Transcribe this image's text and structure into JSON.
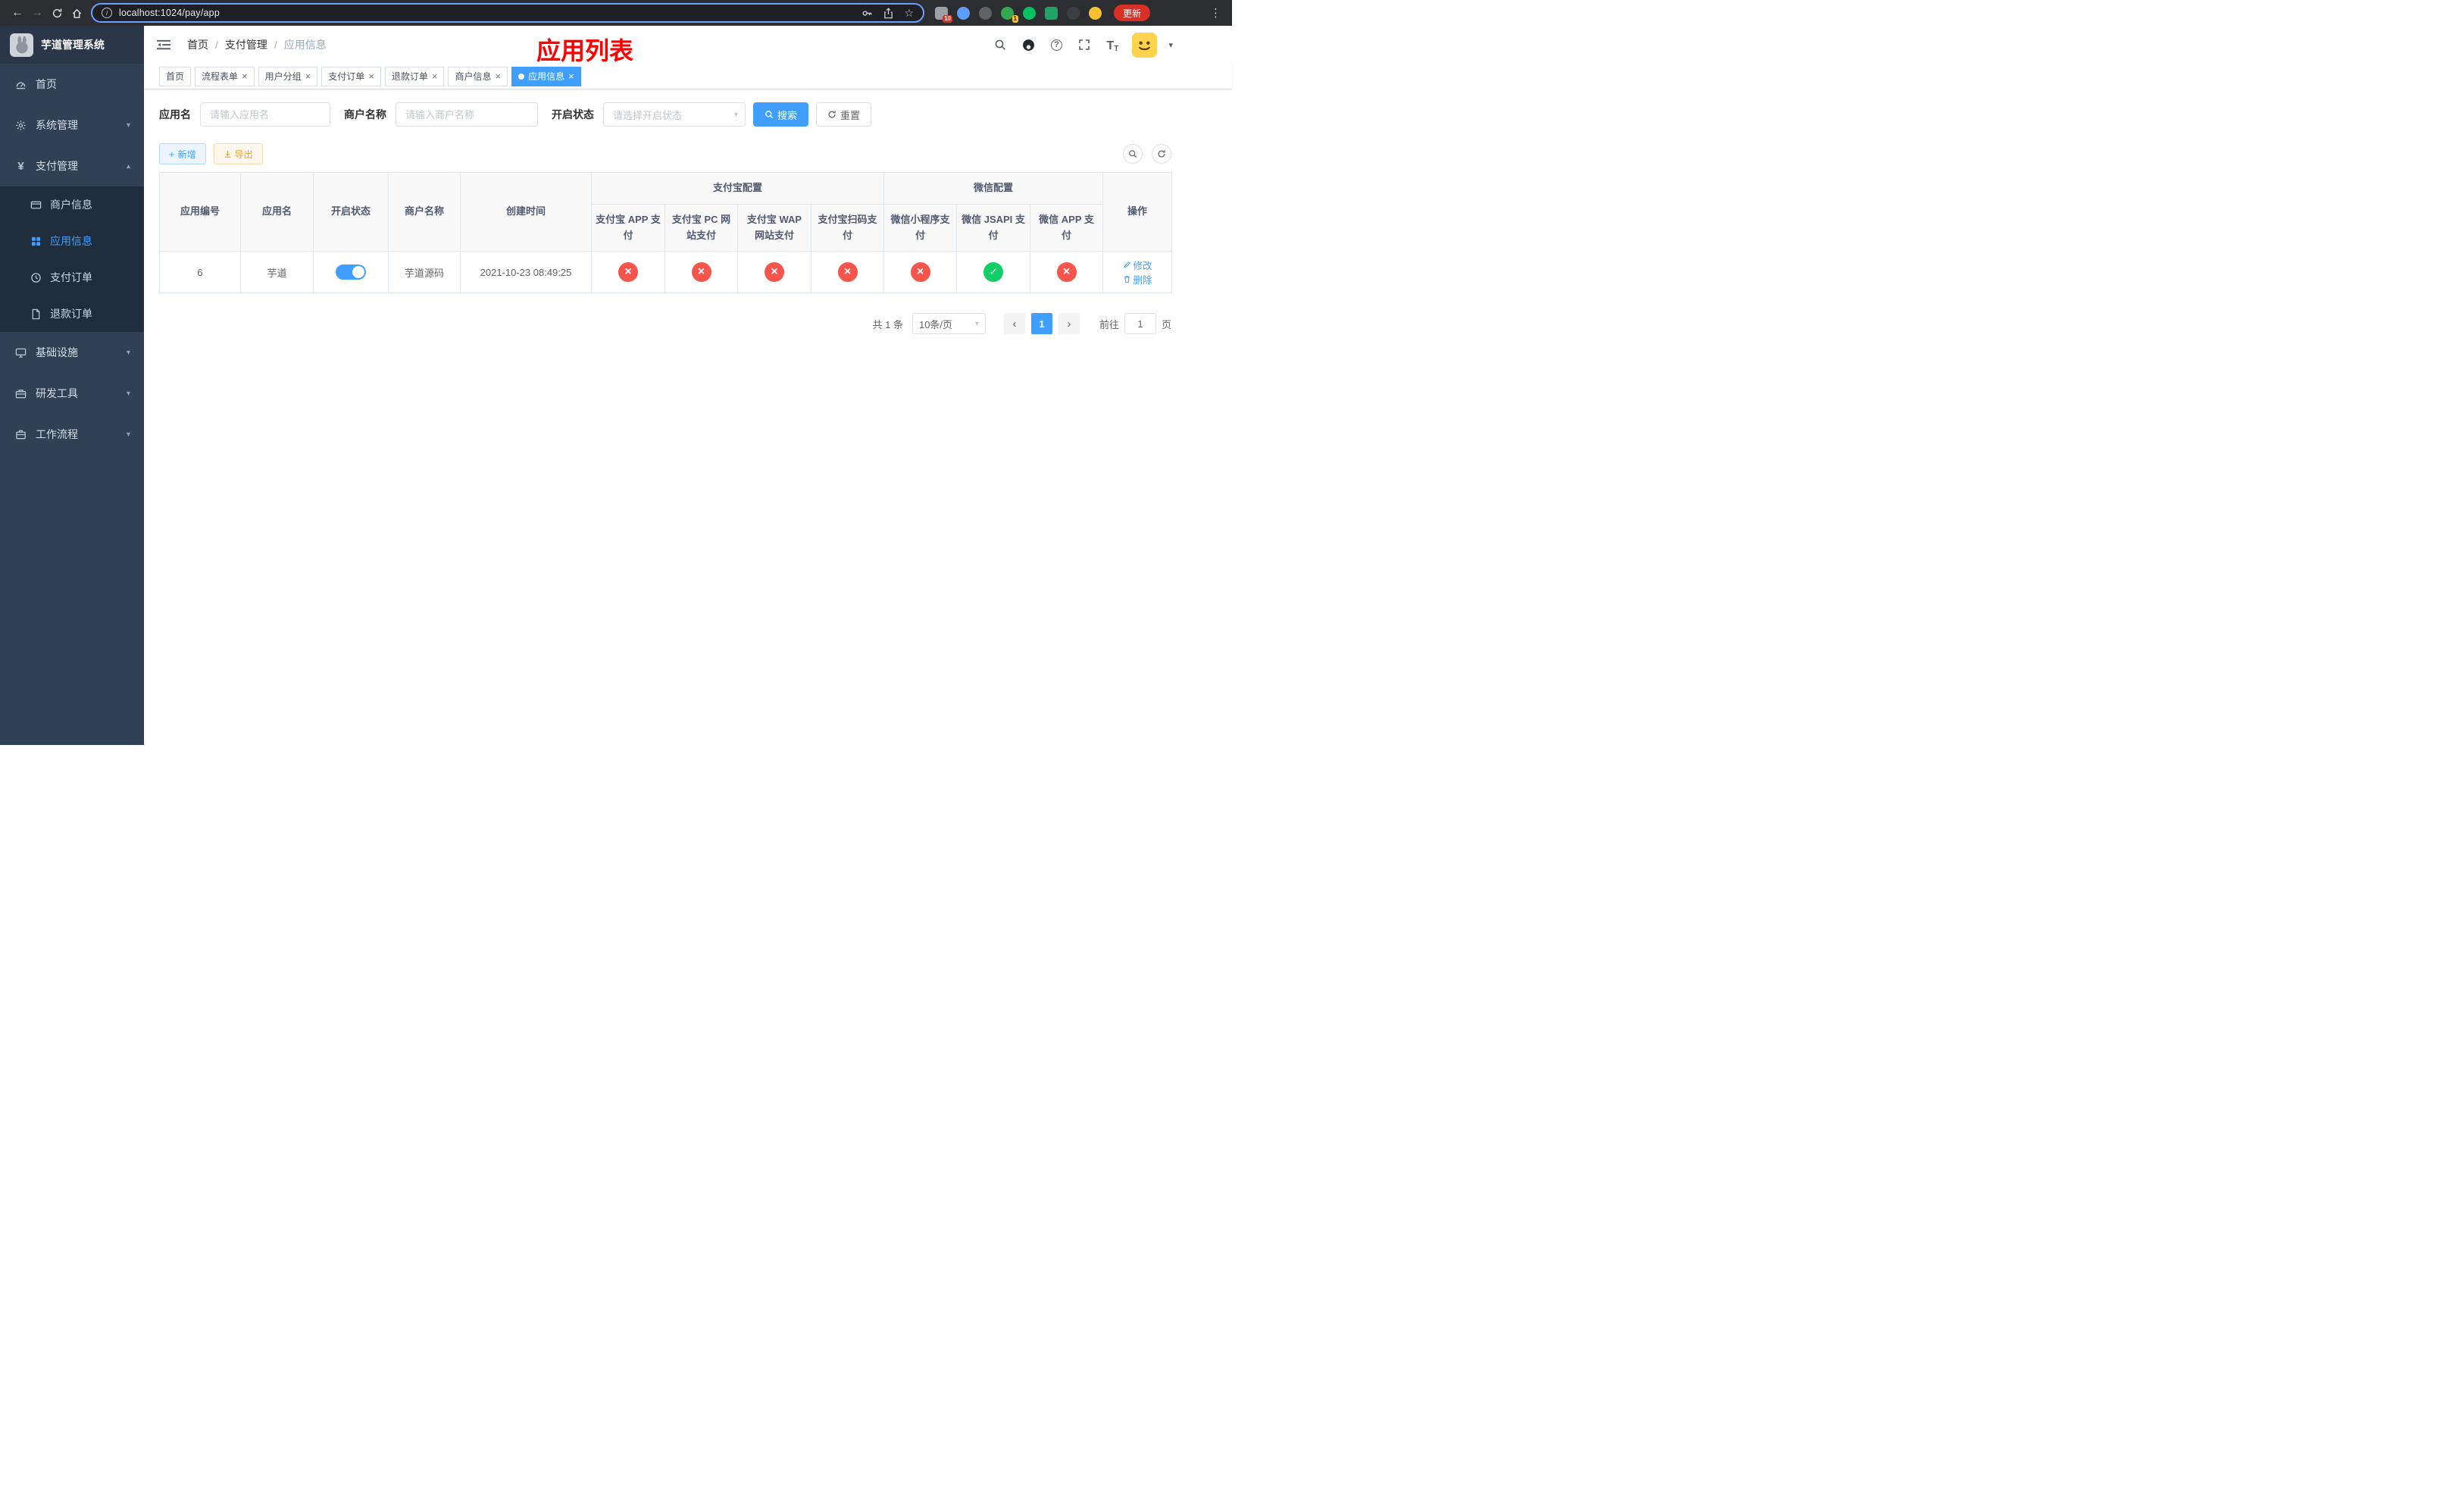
{
  "colors": {
    "accent": "#409eff",
    "success_green": "#13ce66",
    "danger_red": "#f7544c",
    "warning_orange": "#e6a23c",
    "annotation_red": "#fe0000",
    "sidebar_bg": "#304156",
    "submenu_bg": "#1f2d3d"
  },
  "browser": {
    "url": "localhost:1024/pay/app",
    "update_button_label": "更新",
    "puzzle_badge": "10",
    "profile_badge": "1"
  },
  "sidebar": {
    "logo_title": "芋道管理系统",
    "items": [
      {
        "label": "首页"
      },
      {
        "label": "系统管理"
      },
      {
        "label": "支付管理",
        "expanded": true,
        "children": [
          {
            "label": "商户信息"
          },
          {
            "label": "应用信息",
            "active": true
          },
          {
            "label": "支付订单"
          },
          {
            "label": "退款订单"
          }
        ]
      },
      {
        "label": "基础设施"
      },
      {
        "label": "研发工具"
      },
      {
        "label": "工作流程"
      }
    ]
  },
  "navbar": {
    "breadcrumb": [
      "首页",
      "支付管理",
      "应用信息"
    ],
    "separator": "/"
  },
  "annotation": {
    "title": "应用列表"
  },
  "tabs": [
    {
      "label": "首页",
      "closable": false
    },
    {
      "label": "流程表单",
      "closable": true
    },
    {
      "label": "用户分组",
      "closable": true
    },
    {
      "label": "支付订单",
      "closable": true
    },
    {
      "label": "退款订单",
      "closable": true
    },
    {
      "label": "商户信息",
      "closable": true
    },
    {
      "label": "应用信息",
      "closable": true,
      "active": true
    }
  ],
  "filters": {
    "app_name": {
      "label": "应用名",
      "placeholder": "请输入应用名",
      "value": ""
    },
    "merchant_name": {
      "label": "商户名称",
      "placeholder": "请输入商户名称",
      "value": ""
    },
    "status": {
      "label": "开启状态",
      "placeholder": "请选择开启状态",
      "value": ""
    },
    "search_label": "搜索",
    "reset_label": "重置"
  },
  "toolbar": {
    "add_label": "新增",
    "export_label": "导出"
  },
  "table": {
    "columns": [
      "应用编号",
      "应用名",
      "开启状态",
      "商户名称",
      "创建时间"
    ],
    "groups": [
      {
        "label": "支付宝配置",
        "children": [
          "支付宝 APP 支付",
          "支付宝 PC 网站支付",
          "支付宝 WAP 网站支付",
          "支付宝扫码支付"
        ]
      },
      {
        "label": "微信配置",
        "children": [
          "微信小程序支付",
          "微信 JSAPI 支付",
          "微信 APP 支付"
        ]
      }
    ],
    "action_column": "操作",
    "rows": [
      {
        "id": "6",
        "name": "芋道",
        "enabled": "on",
        "merchant_name": "芋道源码",
        "create_time": "2021-10-23 08:49:25",
        "pay_channels": [
          "no",
          "no",
          "no",
          "no",
          "no",
          "yes",
          "no"
        ],
        "edit_label": "修改",
        "delete_label": "删除"
      }
    ]
  },
  "pagination": {
    "total_text": "共 1 条",
    "page_size_text": "10条/页",
    "current_page": "1",
    "jump_prefix": "前往",
    "jump_value": "1",
    "jump_suffix": "页"
  }
}
